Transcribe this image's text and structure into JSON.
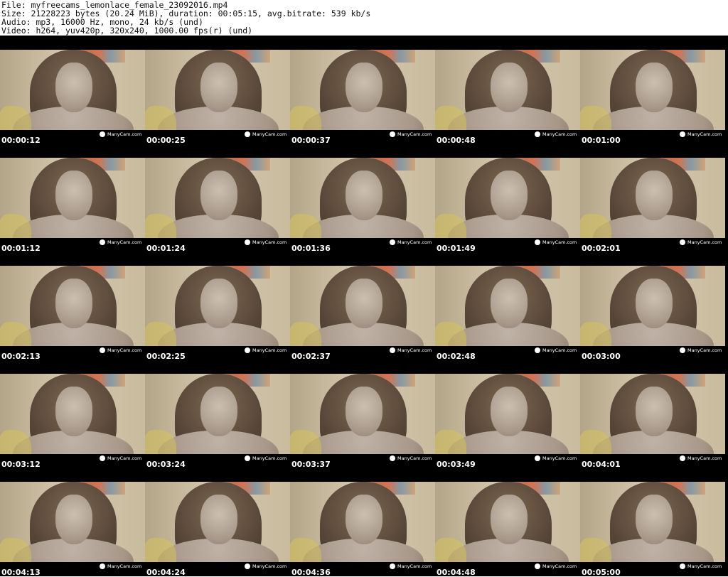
{
  "header": {
    "lines": [
      "File: myfreecams_lemonlace_female_23092016.mp4",
      "Size: 21228223 bytes (20.24 MiB), duration: 00:05:15, avg.bitrate: 539 kb/s",
      "Audio: mp3, 16000 Hz, mono, 24 kb/s (und)",
      "Video: h264, yuv420p, 320x240, 1000.00 fps(r) (und)"
    ]
  },
  "sheet": {
    "watermark": "ManyCam.com",
    "thumbnails": [
      {
        "time": "00:00:12"
      },
      {
        "time": "00:00:25"
      },
      {
        "time": "00:00:37"
      },
      {
        "time": "00:00:48"
      },
      {
        "time": "00:01:00"
      },
      {
        "time": "00:01:12"
      },
      {
        "time": "00:01:24"
      },
      {
        "time": "00:01:36"
      },
      {
        "time": "00:01:49"
      },
      {
        "time": "00:02:01"
      },
      {
        "time": "00:02:13"
      },
      {
        "time": "00:02:25"
      },
      {
        "time": "00:02:37"
      },
      {
        "time": "00:02:48"
      },
      {
        "time": "00:03:00"
      },
      {
        "time": "00:03:12"
      },
      {
        "time": "00:03:24"
      },
      {
        "time": "00:03:37"
      },
      {
        "time": "00:03:49"
      },
      {
        "time": "00:04:01"
      },
      {
        "time": "00:04:13"
      },
      {
        "time": "00:04:24"
      },
      {
        "time": "00:04:36"
      },
      {
        "time": "00:04:48"
      },
      {
        "time": "00:05:00"
      }
    ]
  }
}
